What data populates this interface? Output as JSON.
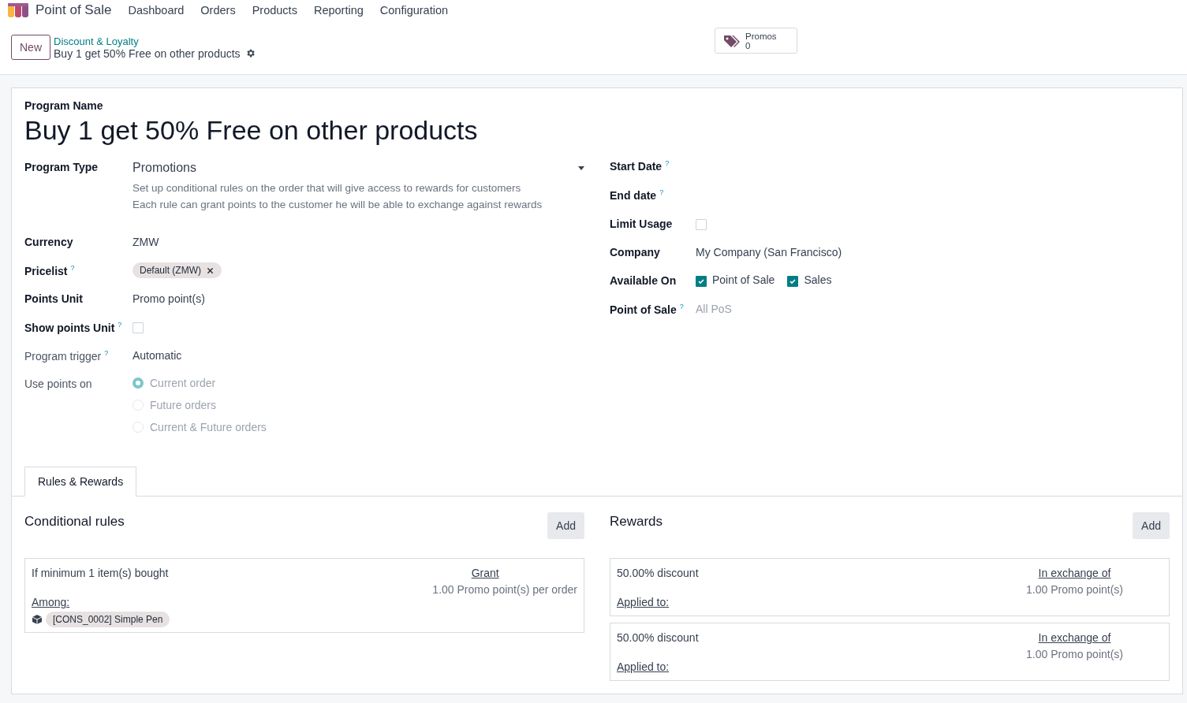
{
  "app": {
    "name": "Point of Sale",
    "menu": [
      "Dashboard",
      "Orders",
      "Products",
      "Reporting",
      "Configuration"
    ]
  },
  "control_panel": {
    "new_button": "New",
    "breadcrumb": "Discount & Loyalty",
    "record": "Buy 1 get 50% Free on other products",
    "smart_button": {
      "label": "Promos",
      "count": "0"
    }
  },
  "form": {
    "name_label": "Program Name",
    "name": "Buy 1 get 50% Free on other products",
    "left_fields": [
      {
        "kind": "select",
        "label": "Program Type",
        "muted": false,
        "value": "Promotions",
        "description": [
          "Set up conditional rules on the order that will give access to rewards for customers",
          "Each rule can grant points to the customer he will be able to exchange against rewards"
        ]
      },
      {
        "kind": "text",
        "label": "Currency",
        "muted": false,
        "value": "ZMW"
      },
      {
        "kind": "tags",
        "label": "Pricelist",
        "help": "?",
        "muted": false,
        "tags": [
          "Default (ZMW)"
        ]
      },
      {
        "kind": "text",
        "label": "Points Unit",
        "muted": false,
        "value": "Promo point(s)"
      },
      {
        "kind": "checkbox",
        "label": "Show points Unit",
        "help": "?",
        "muted": false,
        "checked": false
      },
      {
        "kind": "text",
        "label": "Program trigger",
        "help": "?",
        "muted": true,
        "value": "Automatic"
      },
      {
        "kind": "radio",
        "label": "Use points on",
        "muted": true,
        "options": [
          {
            "label": "Current order",
            "selected": true
          },
          {
            "label": "Future orders",
            "selected": false
          },
          {
            "label": "Current & Future orders",
            "selected": false
          }
        ]
      }
    ],
    "right_fields": [
      {
        "kind": "empty",
        "label": "Start Date",
        "help": "?",
        "muted": false
      },
      {
        "kind": "empty",
        "label": "End date",
        "help": "?",
        "muted": false
      },
      {
        "kind": "checkbox",
        "label": "Limit Usage",
        "muted": false,
        "checked": false
      },
      {
        "kind": "text",
        "label": "Company",
        "muted": false,
        "value": "My Company (San Francisco)"
      },
      {
        "kind": "checks",
        "label": "Available On",
        "muted": false,
        "options": [
          {
            "label": "Point of Sale",
            "checked": true
          },
          {
            "label": "Sales",
            "checked": true
          }
        ]
      },
      {
        "kind": "text",
        "label": "Point of Sale",
        "help": "?",
        "muted": false,
        "placeholder": "All PoS"
      }
    ],
    "tabs": [
      {
        "label": "Rules & Rewards",
        "selected": true
      }
    ],
    "rules": {
      "title": "Conditional rules",
      "add": "Add",
      "items": [
        {
          "condition": "If minimum 1 item(s) bought",
          "among": "Among:",
          "products": [
            "[CONS_0002] Simple Pen"
          ],
          "grant": "Grant",
          "grant_value": "1.00 Promo point(s) per order"
        }
      ]
    },
    "rewards": {
      "title": "Rewards",
      "add": "Add",
      "items": [
        {
          "discount": "50.00% discount",
          "applied": "Applied to:",
          "exchange": "In exchange of",
          "exchange_value": "1.00 Promo point(s)"
        },
        {
          "discount": "50.00% discount",
          "applied": "Applied to:",
          "exchange": "In exchange of",
          "exchange_value": "1.00 Promo point(s)"
        }
      ]
    }
  }
}
